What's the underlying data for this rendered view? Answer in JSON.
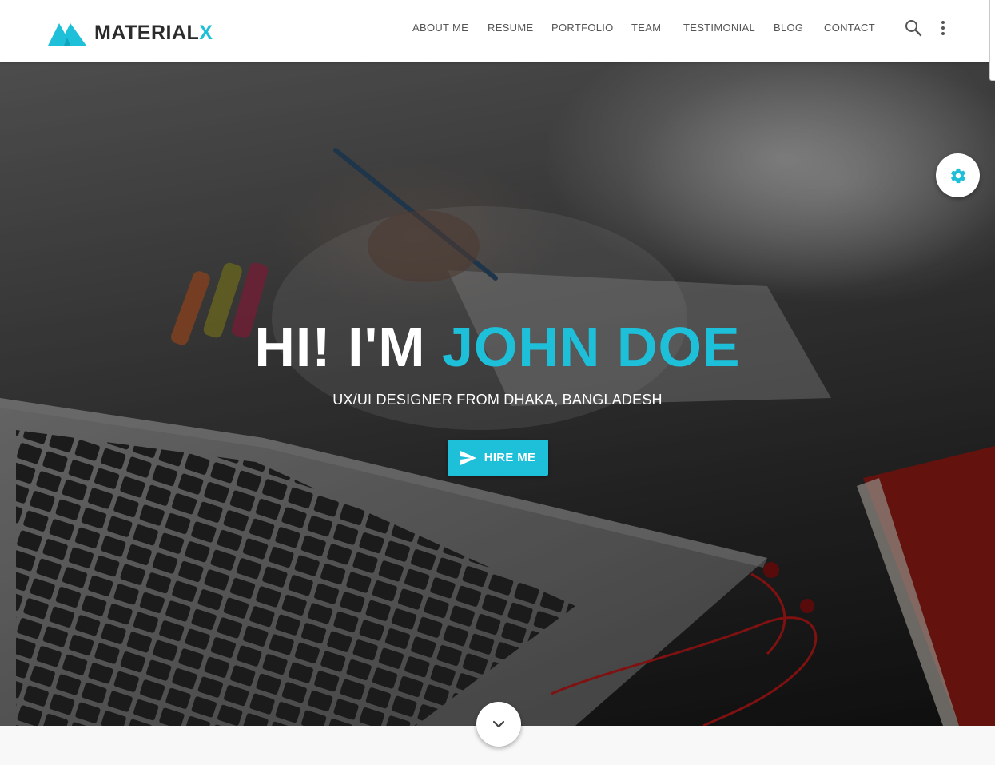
{
  "brand": {
    "name_main": "MATERIAL",
    "name_accent": "X",
    "accent_color": "#1dbfd9"
  },
  "nav": {
    "items": [
      {
        "label": "ABOUT ME"
      },
      {
        "label": "RESUME"
      },
      {
        "label": "PORTFOLIO"
      },
      {
        "label": "TEAM"
      },
      {
        "label": "TESTIMONIAL"
      },
      {
        "label": "BLOG"
      },
      {
        "label": "CONTACT"
      }
    ],
    "icons": [
      "search-icon",
      "more-vertical-icon"
    ]
  },
  "hero": {
    "title_prefix": "HI! I'M",
    "title_name": "JOHN DOE",
    "subtitle": "UX/UI DESIGNER FROM DHAKA, BANGLADESH",
    "cta_label": "HIRE ME",
    "cta_icon": "send-icon"
  },
  "floating": {
    "settings_icon": "gear-icon",
    "scroll_icon": "chevron-down-icon"
  }
}
